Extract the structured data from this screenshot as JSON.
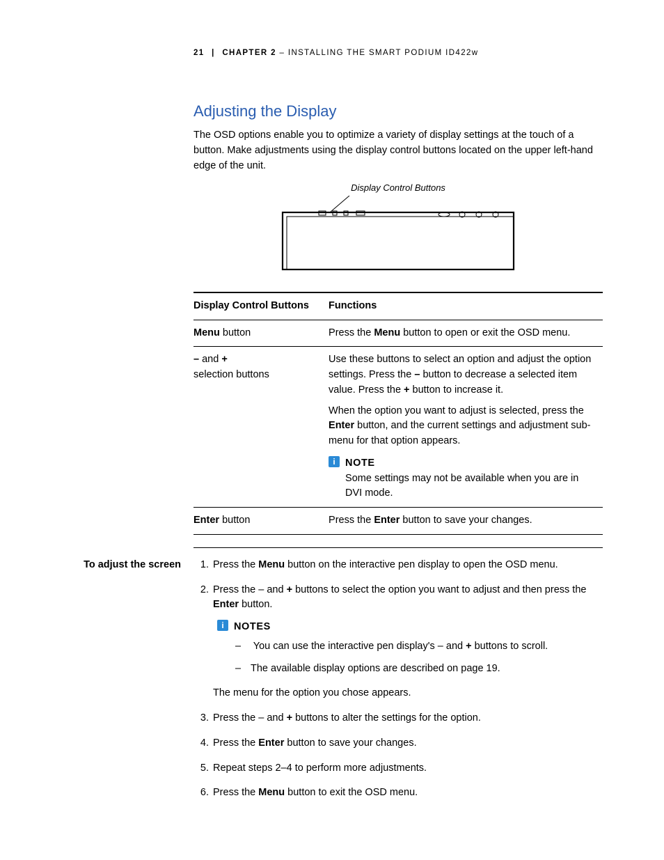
{
  "header": {
    "page_number": "21",
    "separator": "|",
    "chapter_label": "CHAPTER 2",
    "chapter_title": " – INSTALLING THE SMART PODIUM ID422w"
  },
  "section": {
    "title": "Adjusting the Display",
    "intro": "The OSD options enable you to optimize a variety of display settings at the touch of a button. Make adjustments using the display control buttons located on the upper left-hand edge of the unit.",
    "figure_caption": "Display Control Buttons"
  },
  "table": {
    "head_a": "Display Control Buttons",
    "head_b": "Functions",
    "row1": {
      "a_pre": "Menu",
      "a_post": " button",
      "b_pre": "Press the ",
      "b_bold": "Menu",
      "b_post": " button to open or exit the OSD menu."
    },
    "row2": {
      "a_line1_pre": "–",
      "a_line1_mid": " and ",
      "a_line1_suf": "+",
      "a_line2": "selection buttons",
      "b_p1_pre": "Use these buttons to select an option and adjust the option settings. Press the ",
      "b_p1_bold1": "–",
      "b_p1_mid": " button to decrease a selected item value. Press the ",
      "b_p1_bold2": "+",
      "b_p1_post": " button to increase it.",
      "b_p2_pre": "When the option you want to adjust is selected, press the ",
      "b_p2_bold": "Enter",
      "b_p2_post": " button, and the current settings and adjustment sub-menu for that option appears.",
      "note_title": "NOTE",
      "note_body": "Some settings may not be available when you are in DVI mode."
    },
    "row3": {
      "a_pre": "Enter",
      "a_post": " button",
      "b_pre": "Press the ",
      "b_bold": "Enter",
      "b_post": " button to save your changes."
    }
  },
  "procedure": {
    "label": "To adjust the screen",
    "step1_pre": "Press the ",
    "step1_bold": "Menu",
    "step1_post": " button on the interactive pen display to open the OSD menu.",
    "step2_pre": "Press the – and ",
    "step2_bold1": "+",
    "step2_mid": " buttons to select the option you want to adjust and then press the ",
    "step2_bold2": "Enter",
    "step2_post": " button.",
    "notes_title": "NOTES",
    "note_a_pre": "You can use the interactive pen display's – and ",
    "note_a_bold": "+",
    "note_a_post": " buttons to scroll.",
    "note_b": "The available display options are described on page 19.",
    "step2_after": "The menu for the option you chose appears.",
    "step3_pre": "Press the – and ",
    "step3_bold": "+",
    "step3_post": " buttons to alter the settings for the option.",
    "step4_pre": "Press the ",
    "step4_bold": "Enter",
    "step4_post": " button to save your changes.",
    "step5": "Repeat steps 2–4 to perform more adjustments.",
    "step6_pre": "Press the ",
    "step6_bold": "Menu",
    "step6_post": " button to exit the OSD menu."
  }
}
